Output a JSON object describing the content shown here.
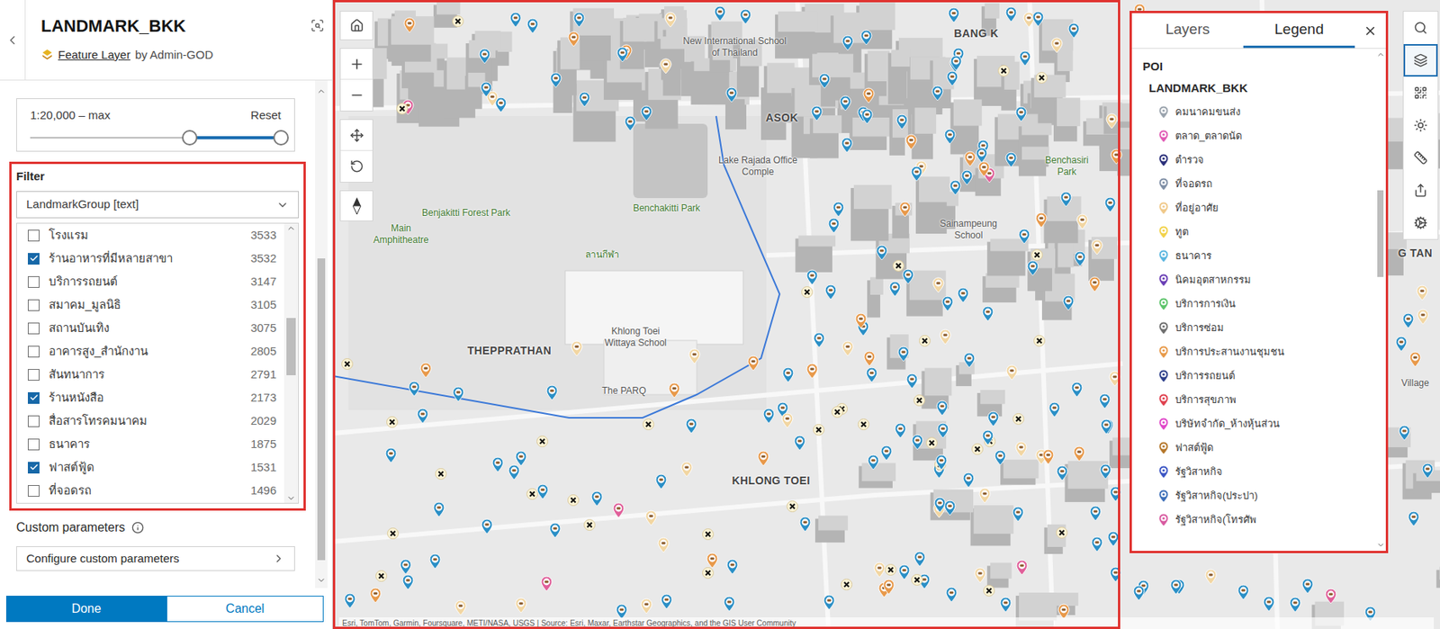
{
  "item": {
    "title": "LANDMARK_BKK",
    "type": "Feature Layer",
    "owner": "by Admin-GOD"
  },
  "visible_range": {
    "label": "1:20,000  –  max",
    "reset": "Reset",
    "min_level": 0.635,
    "max_level": 1
  },
  "filter": {
    "title": "Filter",
    "field": "LandmarkGroup [text]",
    "values": [
      {
        "label": "โรงแรม",
        "count": "3533",
        "checked": false
      },
      {
        "label": "ร้านอาหารที่มีหลายสาขา",
        "count": "3532",
        "checked": true
      },
      {
        "label": "บริการรถยนต์",
        "count": "3147",
        "checked": false
      },
      {
        "label": "สมาคม_มูลนิธิ",
        "count": "3105",
        "checked": false
      },
      {
        "label": "สถานบันเทิง",
        "count": "3075",
        "checked": false
      },
      {
        "label": "อาคารสูง_สำนักงาน",
        "count": "2805",
        "checked": false
      },
      {
        "label": "สันทนาการ",
        "count": "2791",
        "checked": false
      },
      {
        "label": "ร้านหนังสือ",
        "count": "2173",
        "checked": true
      },
      {
        "label": "สื่อสารโทรคมนาคม",
        "count": "2029",
        "checked": false
      },
      {
        "label": "ธนาคาร",
        "count": "1875",
        "checked": false
      },
      {
        "label": "ฟาสต์ฟู้ด",
        "count": "1531",
        "checked": true
      },
      {
        "label": "ที่จอดรถ",
        "count": "1496",
        "checked": false
      }
    ]
  },
  "custom_parameters": {
    "title": "Custom parameters",
    "button": "Configure custom parameters"
  },
  "buttons": [
    {
      "label": "Done",
      "primary": true
    },
    {
      "label": "Cancel",
      "primary": false
    }
  ],
  "map": {
    "labels": [
      {
        "text": "New International School of Thailand",
        "kind": "place"
      },
      {
        "text": "ASOK",
        "kind": "district"
      },
      {
        "text": "Lake Rajada Office Comple",
        "kind": "place"
      },
      {
        "text": "Benchakitti Park",
        "kind": "park"
      },
      {
        "text": "Benjakitti Forest Park",
        "kind": "park"
      },
      {
        "text": "Main Amphitheatre",
        "kind": "park"
      },
      {
        "text": "ลานกีฬา",
        "kind": "park"
      },
      {
        "text": "THEPPRATHAN",
        "kind": "district"
      },
      {
        "text": "Khlong Toei Wittaya School",
        "kind": "place"
      },
      {
        "text": "The PARQ",
        "kind": "place"
      },
      {
        "text": "KHLONG TOEI",
        "kind": "district"
      },
      {
        "text": "Sainampeung School",
        "kind": "place"
      },
      {
        "text": "Benchasiri Park",
        "kind": "park"
      },
      {
        "text": "BANG K",
        "kind": "district"
      },
      {
        "text": "G TAN",
        "kind": "district"
      },
      {
        "text": "Village",
        "kind": "place"
      }
    ],
    "pin_colors": [
      "#2a8fc6",
      "#f2d6a2",
      "#e8994a",
      "#e0609a"
    ],
    "attribution": "Esri, TomTom, Garmin, Foursquare, METI/NASA, USGS | Source: Esri, Maxar, Earthstar Geographics, and the GIS User Community"
  },
  "panel": {
    "tabs": [
      {
        "label": "Layers",
        "selected": false
      },
      {
        "label": "Legend",
        "selected": true
      }
    ],
    "group": "POI",
    "layer": "LANDMARK_BKK",
    "items": [
      {
        "label": "คมนาคมขนส่ง",
        "color": "#9aa3ad"
      },
      {
        "label": "ตลาด_ตลาดนัด",
        "color": "#e05bb5"
      },
      {
        "label": "ตำรวจ",
        "color": "#2a2f7a"
      },
      {
        "label": "ที่จอดรถ",
        "color": "#7f8fa6"
      },
      {
        "label": "ที่อยู่อาศัย",
        "color": "#f0c98a"
      },
      {
        "label": "ทูต",
        "color": "#f2d24a"
      },
      {
        "label": "ธนาคาร",
        "color": "#5bb6e0"
      },
      {
        "label": "นิคมอุตสาหกรรม",
        "color": "#6a3fb5"
      },
      {
        "label": "บริการการเงิน",
        "color": "#5cc46a"
      },
      {
        "label": "บริการซ่อม",
        "color": "#6f6f6f"
      },
      {
        "label": "บริการประสานงานชุมชน",
        "color": "#e89a4a"
      },
      {
        "label": "บริการรถยนต์",
        "color": "#2d3f8a"
      },
      {
        "label": "บริการสุขภาพ",
        "color": "#e0414f"
      },
      {
        "label": "บริษัทจำกัด_ห้างหุ้นส่วน",
        "color": "#e048c9"
      },
      {
        "label": "ฟาสต์ฟู้ด",
        "color": "#b5772a"
      },
      {
        "label": "รัฐวิสาหกิจ",
        "color": "#3b55c4"
      },
      {
        "label": "รัฐวิสาหกิจ(ประปา)",
        "color": "#3d6fb8"
      },
      {
        "label": "รัฐวิสาหกิจ(โทรศัพ",
        "color": "#d85aa0"
      }
    ]
  },
  "toolbar": [
    {
      "selected": false
    },
    {
      "selected": true
    },
    {
      "selected": false
    },
    {
      "selected": false
    },
    {
      "selected": false
    },
    {
      "selected": false
    },
    {
      "selected": false
    }
  ]
}
